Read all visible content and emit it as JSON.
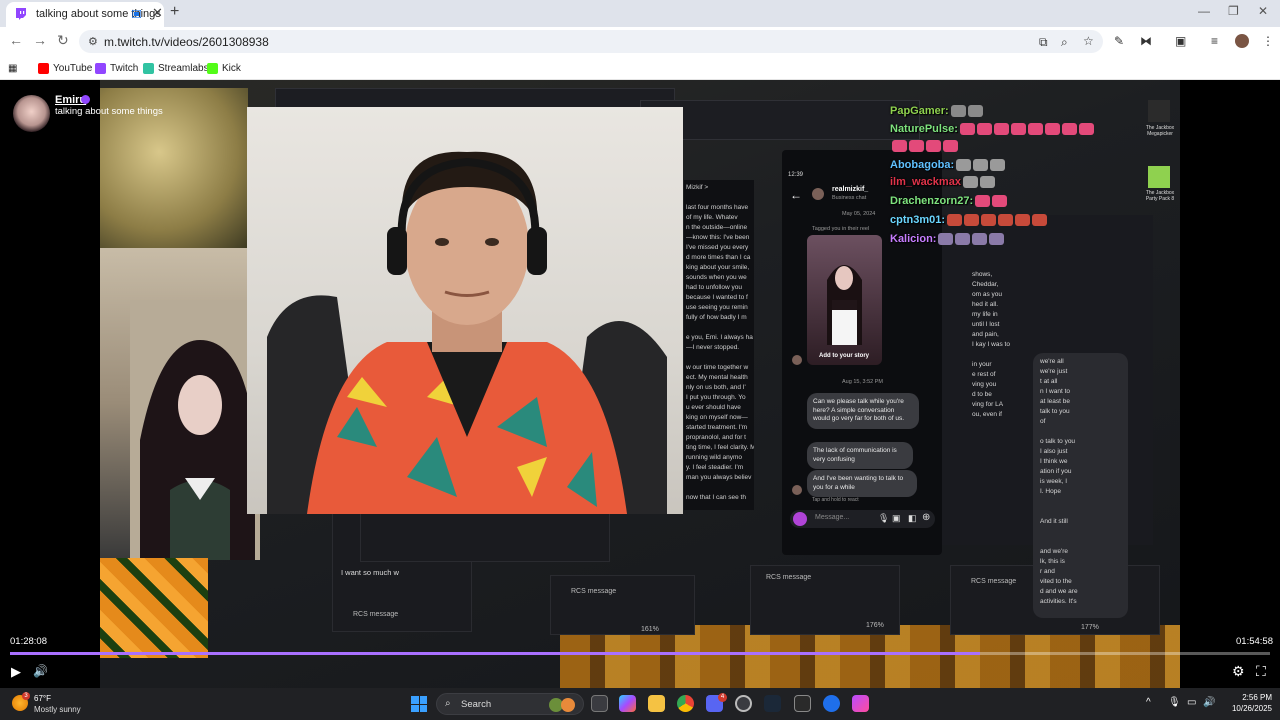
{
  "browser": {
    "tab_title": "talking about some things",
    "tab_close": "✕",
    "new_tab": "+",
    "window": {
      "minimize": "—",
      "restore": "❐",
      "close": "✕"
    },
    "url": "m.twitch.tv/videos/2601308938",
    "nav": {
      "back": "←",
      "forward": "→",
      "reload": "↻"
    },
    "bookmarks": [
      {
        "label": "YouTube",
        "color": "#ff0000"
      },
      {
        "label": "Twitch",
        "color": "#9146ff"
      },
      {
        "label": "Streamlabs",
        "color": "#31c3a2"
      },
      {
        "label": "Kick",
        "color": "#53fc18"
      }
    ]
  },
  "video": {
    "channel_name": "Emiru",
    "stream_title": "talking about some things",
    "time_current": "01:28:08",
    "time_total": "01:54:58",
    "progress_fraction": 0.77,
    "chat_left_text": "Mizkif >\n\nlast four months have\nof my life. Whatev\nn the outside—online\n—know this: I've been\nI've missed you every\nd more times than I ca\nking about your smile,\nsounds when you we\nhad to unfollow you\nbecause I wanted to f\nuse seeing you remin\nfully of how badly I m\n\ne you, Emi. I always ha\n—I never stopped.\n\nw our time together w\nect. My mental health\nnly on us both, and I'\nI put you through. Yo\nu ever should have\nking on myself now—\nstarted treatment. I'm\npropranolol, and for t\nting time, I feel clarity. M\nrunning wild anymo\ny. I feel steadier. I'm\nman you always believ\n\nnow that I can see th",
    "phone_header": "realmizkif_",
    "phone_subheader": "Business chat",
    "phone_date_1": "May 05, 2024",
    "story_caption": "Tagged you in their reel",
    "add_to_story": "Add to your story",
    "phone_date_2": "Aug 15, 3:52 PM",
    "bubbles": [
      "Can we please talk while you're here? A simple conversation would go very far for both of us.",
      "The lack of communication is very confusing",
      "And I've been wanting to talk to you for a while"
    ],
    "tap_hold": "Tap and hold to react",
    "message_placeholder": "Message...",
    "phone_time": "12:39",
    "right_chat_left": "shows,\nCheddar,\nom as you\nhed it all.\nmy life in\nuntil I lost\nand pain,\nI kay I was to\n\nin your\ne rest of\nving you\nd to be\nving for LA\nou, even if",
    "right_chat_right": "we're all\nwe're just\nt at all\nn I want to\nat least be\ntalk to you\nof\n\no talk to you\nI also just\nI think we\nation if you\nis week, I\nI. Hope\n\n\nAnd it still\n\n\nand we're\nlk, this is\nr and\nvited to the\nd and we are\nactivities. It's",
    "emote_chat": [
      {
        "user": "PapGamer:",
        "color": "#8fd14f"
      },
      {
        "user": "NaturePulse:",
        "color": "#7ee27e"
      },
      {
        "user": "Abobagoba:",
        "color": "#5fc0ff"
      },
      {
        "user": "ilm_wackmax",
        "color": "#e0334a"
      },
      {
        "user": "Drachenzorn27:",
        "color": "#7ee27e"
      },
      {
        "user": "cptn3m01:",
        "color": "#6bd6ff"
      },
      {
        "user": "Kalicion:",
        "color": "#c77dff"
      }
    ],
    "rcs_labels": [
      "RCS message",
      "RCS message",
      "RCS message",
      "RCS message"
    ],
    "zoom_labels": [
      "161%",
      "176%",
      "177%",
      "161%"
    ],
    "side_items": [
      {
        "label": "The Jackbox Megapicker",
        "color": "#2b2b2b"
      },
      {
        "label": "The Jackbox Party Pack 8",
        "color": "#8fd14f"
      }
    ],
    "typed_text": "I want so much w",
    "flower_accent": "#e58a1b",
    "play_icon": "▶",
    "volume_icon": "🔊",
    "settings_icon": "⚙",
    "fullscreen_icon": "⛶"
  },
  "taskbar": {
    "weather_badge": "3",
    "temperature": "67°F",
    "condition": "Mostly sunny",
    "search_placeholder": "Search",
    "time": "2:56 PM",
    "date": "10/26/2025",
    "discord_badge": "4",
    "tray_chevron": "^"
  }
}
